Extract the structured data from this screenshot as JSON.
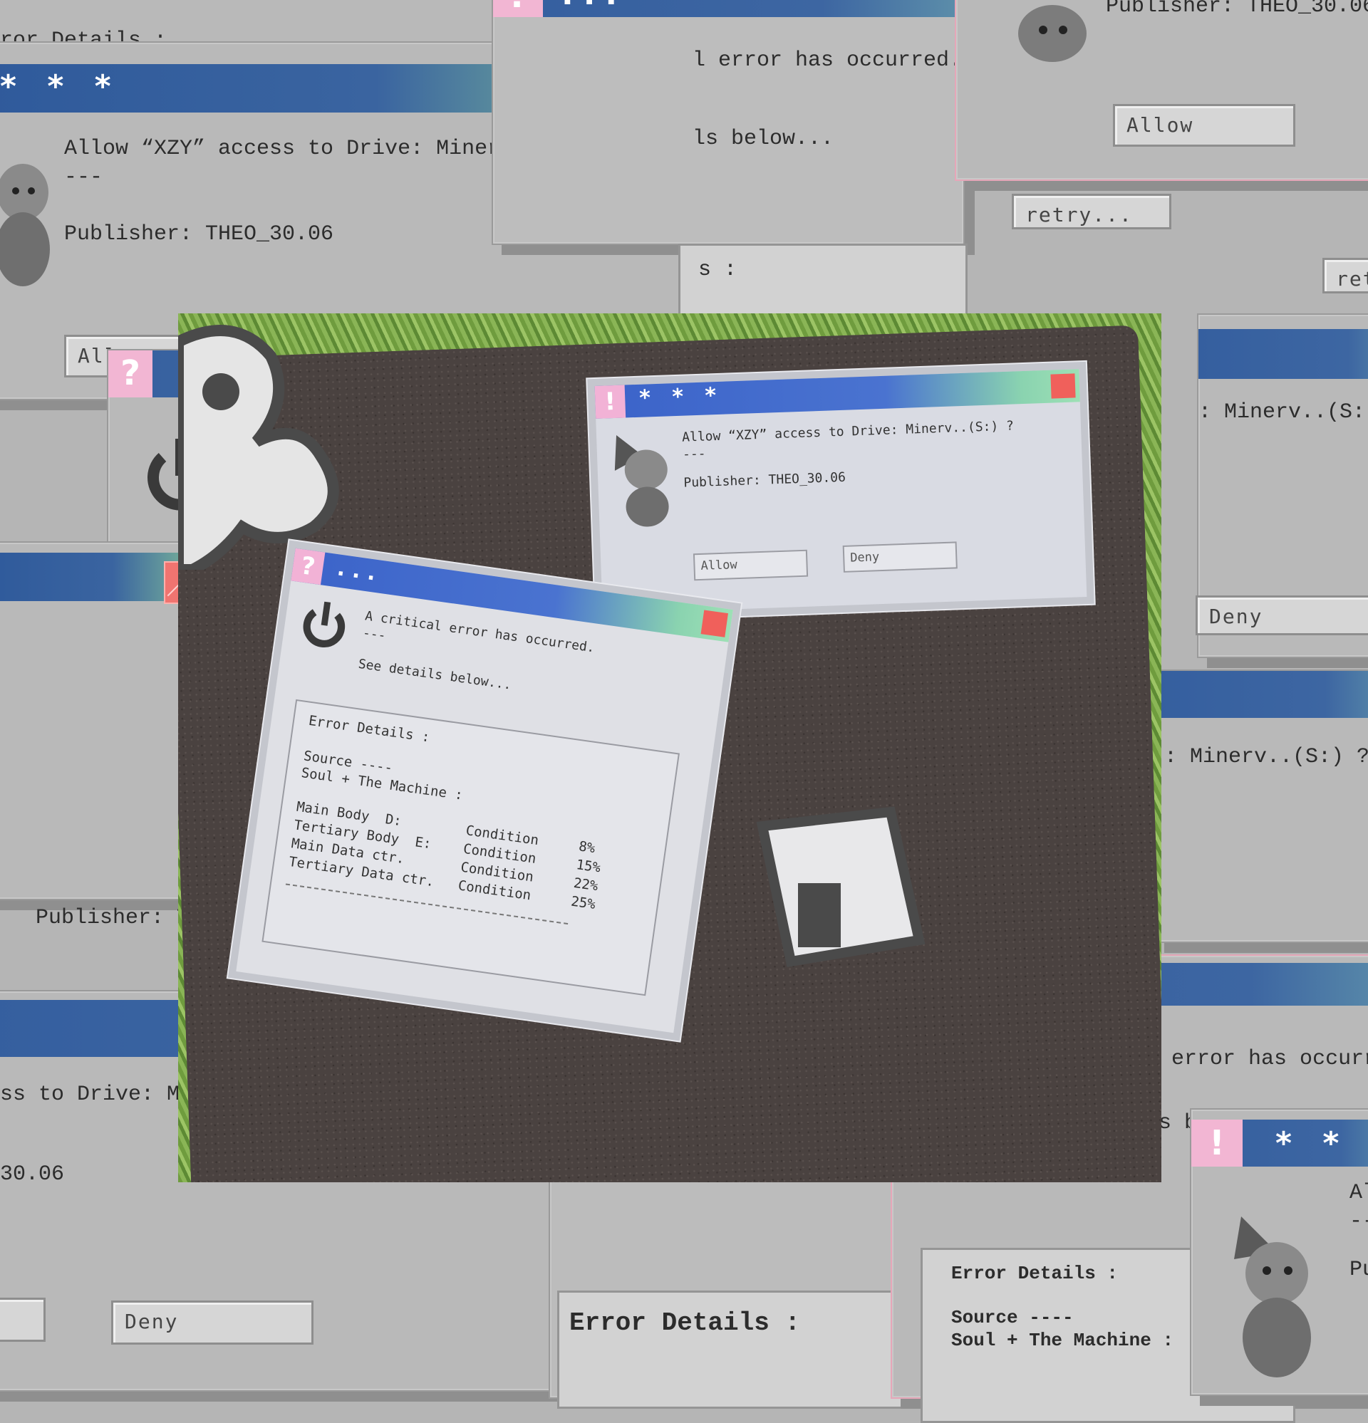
{
  "dialog_allow": {
    "title": "* * *",
    "prompt": "Allow “XZY” access to Drive: Minerv..(S:) ?",
    "separator": "---",
    "publisher": "Publisher: THEO_30.06",
    "allow_label": "Allow",
    "deny_label": "Deny"
  },
  "dialog_error": {
    "title": "...",
    "message": "A critical error has occurred.",
    "separator": "---",
    "see_details": "See details below...",
    "retry_label": "retry...",
    "details_heading": "Error Details :",
    "source_line": "Source ----",
    "source_value": "Soul + The Machine :",
    "rows": [
      {
        "label": "Main Body  D:",
        "condition": "Condition",
        "value": "8%"
      },
      {
        "label": "Tertiary Body  E:",
        "condition": "Condition",
        "value": "15%"
      },
      {
        "label": "Main Data ctr.",
        "condition": "Condition",
        "value": "22%"
      },
      {
        "label": "Tertiary Data ctr.",
        "condition": "Condition",
        "value": "25%"
      }
    ]
  },
  "fragments": {
    "top_left_details": "rror Details :",
    "error_partial": "l error has occurred.",
    "details_partial": "ls below...",
    "publisher_top": "Publisher: THEO_30.06",
    "allow_partial": "All",
    "allow_right": "Allow",
    "retry_right": "retry...",
    "retry_edge": "retr",
    "colon_partial": "s :",
    "drive_right": ": Minerv..(S:) ?",
    "drive_right2": ": Minerv..(S:) ?",
    "deny_right": "Deny",
    "a_partial": "A",
    "dash_partial": "--",
    "se_partial": "Se",
    "publisher_left": "Publisher: THEO_",
    "drive_left": "ss to Drive: Miner",
    "publisher_num": "30.06",
    "deny_left": "Deny",
    "details_big": "Error Details :",
    "br_al": "Al",
    "br_dash": "--",
    "br_pul": "Pul"
  },
  "icons": {
    "help": "question-mark",
    "warning": "exclamation-mark",
    "power": "power-gear-icon",
    "mascot": "dog-illustration"
  },
  "colors": {
    "titlebar_start": "#2f5a9b",
    "titlebar_end": "#8cc59c",
    "close": "#f07470",
    "icon_pink": "#f2b6d3",
    "window_gray": "#b9b9b9"
  }
}
